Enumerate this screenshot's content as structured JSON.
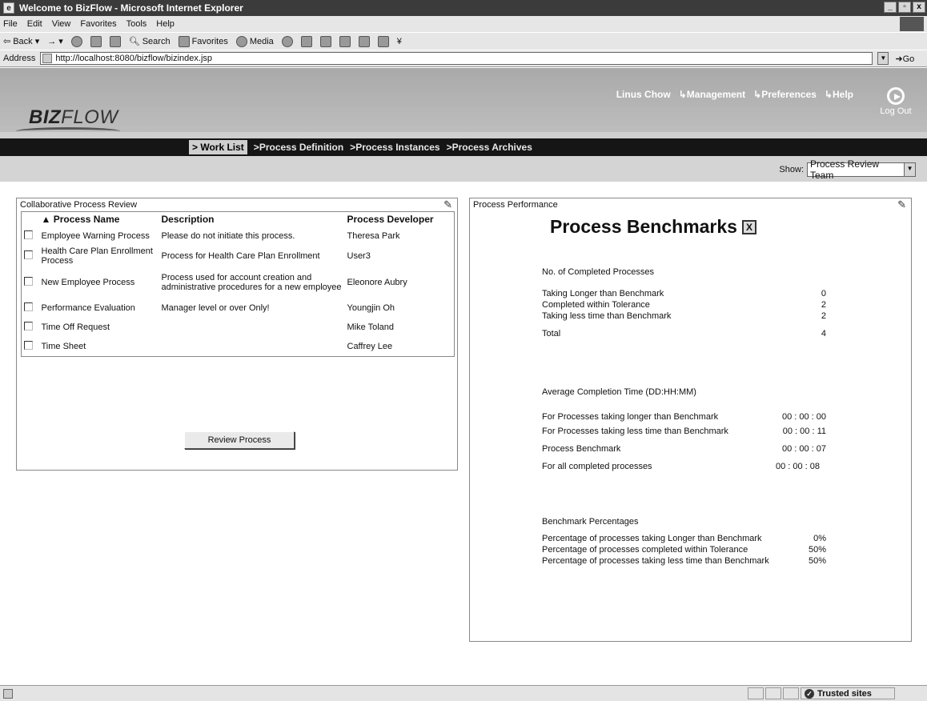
{
  "browser": {
    "title": "Welcome to BizFlow - Microsoft Internet Explorer",
    "window_buttons": [
      "_",
      "▫",
      "x"
    ],
    "menu": [
      "File",
      "Edit",
      "View",
      "Favorites",
      "Tools",
      "Help"
    ],
    "toolbar": {
      "back": "Back",
      "search": "Search",
      "favorites": "Favorites",
      "media": "Media"
    },
    "address_label": "Address",
    "address_url": "http://localhost:8080/bizflow/bizindex.jsp",
    "go_label": "Go"
  },
  "app": {
    "logo_bold": "BIZ",
    "logo_light": "FLOW",
    "user": "Linus Chow",
    "links": [
      "Management",
      "Preferences",
      "Help"
    ],
    "logout": "Log Out",
    "nav": [
      "Work List",
      "Process Definition",
      "Process Instances",
      "Process Archives"
    ],
    "show_label": "Show:",
    "show_value": "Process Review Team"
  },
  "worklist": {
    "panel_title": "Collaborative Process Review",
    "columns": [
      "▲ Process Name",
      "Description",
      "Process Developer"
    ],
    "rows": [
      {
        "name": "Employee Warning Process",
        "description": "Please do not initiate this process.",
        "developer": "Theresa Park"
      },
      {
        "name": "Health Care Plan Enrollment Process",
        "description": "Process for Health Care Plan Enrollment",
        "developer": "User3"
      },
      {
        "name": "New Employee Process",
        "description": "Process used for account creation and administrative procedures for a new employee",
        "developer": "Eleonore Aubry"
      },
      {
        "name": "Performance Evaluation",
        "description": "Manager level or over Only!",
        "developer": "Youngjin Oh"
      },
      {
        "name": "Time Off Request",
        "description": "",
        "developer": "Mike Toland"
      },
      {
        "name": "Time Sheet",
        "description": "",
        "developer": "Caffrey Lee"
      }
    ],
    "button": "Review Process"
  },
  "performance": {
    "panel_title": "Process Performance",
    "heading": "Process Benchmarks",
    "completed": {
      "title": "No. of Completed Processes",
      "rows": [
        {
          "label": "Taking Longer than Benchmark",
          "value": "0"
        },
        {
          "label": "Completed within Tolerance",
          "value": "2"
        },
        {
          "label": "Taking less time than Benchmark",
          "value": "2"
        }
      ],
      "total_label": "Total",
      "total_value": "4"
    },
    "avg_time": {
      "title": "Average Completion Time (DD:HH:MM)",
      "rows": [
        {
          "label": "For Processes taking longer than Benchmark",
          "value": "00 : 00 : 00"
        },
        {
          "label": "For Processes taking less time than Benchmark",
          "value": "00 : 00 : 11"
        },
        {
          "label": "Process Benchmark",
          "value": "00 : 00 : 07"
        },
        {
          "label": "For all completed processes",
          "value": "00 : 00 : 08"
        }
      ]
    },
    "percentages": {
      "title": "Benchmark Percentages",
      "rows": [
        {
          "label": "Percentage of processes taking Longer than Benchmark",
          "value": "0%"
        },
        {
          "label": "Percentage of processes completed within Tolerance",
          "value": "50%"
        },
        {
          "label": "Percentage of processes taking less time than Benchmark",
          "value": "50%"
        }
      ]
    }
  },
  "status": {
    "zone": "Trusted sites"
  }
}
